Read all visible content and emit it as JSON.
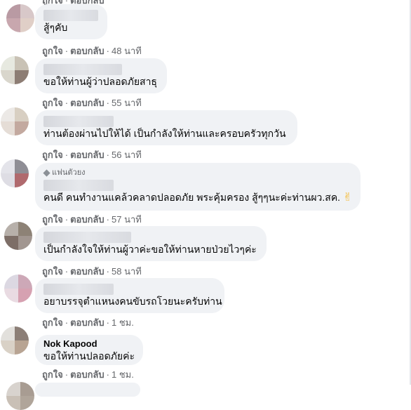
{
  "actions": {
    "like": "ถูกใจ",
    "reply": "ตอบกลับ"
  },
  "comments": [
    {
      "text": "สู้ๆคับ",
      "time": "48 นาที"
    },
    {
      "text": "ขอให้ท่านผู้ว่าปลอดภัยสาธุ",
      "time": "55 นาที"
    },
    {
      "text": "ท่านต้องผ่านไปให้ได้ เป็นกำลังให้ท่านและครอบครัวทุกวัน",
      "time": "56 นาที"
    },
    {
      "badge": "แฟนตัวยง",
      "text": "คนดี คนทำงานแคล้วคลาดปลอดภัย พระคุ้มครอง สู้ๆๆนะค่ะท่านผว.สค.",
      "emoji": "✌",
      "time": "57 นาที"
    },
    {
      "text": "เป็นกำลังใจให้ท่านผู้วาค่ะขอให้ท่านหายป่วยไวๆค่ะ",
      "time": "58 นาที"
    },
    {
      "text": "อยาบรรจุตำแหนงคนขับรถโวยนะครับท่าน",
      "time": "1 ชม."
    },
    {
      "name": "Nok Kapood",
      "text": "ขอให้ท่านปลอดภัยค่ะ",
      "time": "1 ชม."
    }
  ]
}
